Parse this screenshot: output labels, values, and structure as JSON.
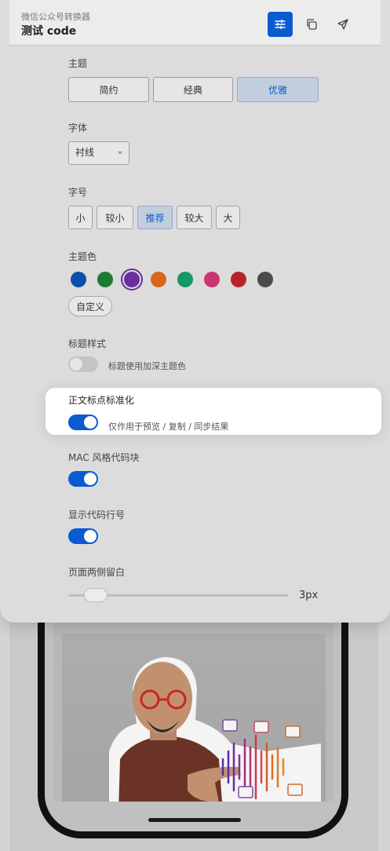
{
  "header": {
    "subtitle": "微信公众号转换器",
    "title": "测试 code",
    "buttons": [
      {
        "icon": "sliders-icon",
        "active": true
      },
      {
        "icon": "copy-icon"
      },
      {
        "icon": "send-icon"
      }
    ]
  },
  "theme": {
    "label": "主题",
    "options": [
      "简约",
      "经典",
      "优雅"
    ],
    "selected": "优雅"
  },
  "font": {
    "label": "字体",
    "value": "衬线"
  },
  "font_size": {
    "label": "字号",
    "options": [
      "小",
      "较小",
      "推荐",
      "较大",
      "大"
    ],
    "selected": "推荐"
  },
  "theme_color": {
    "label": "主题色",
    "swatches": [
      "#0a4fa8",
      "#1f7a34",
      "#6a2e9e",
      "#d8671d",
      "#149868",
      "#c93670",
      "#b8232b",
      "#4a4a4a"
    ],
    "selected_index": 2,
    "custom_label": "自定义"
  },
  "heading_style": {
    "label": "标题样式",
    "toggle_on": false,
    "description": "标题使用加深主题色"
  },
  "punctuation": {
    "label": "正文标点标准化",
    "toggle_on": true,
    "description": "仅作用于预览 / 复制 / 同步结果"
  },
  "mac_code": {
    "label": "MAC 风格代码块",
    "toggle_on": true
  },
  "line_numbers": {
    "label": "显示代码行号",
    "toggle_on": true
  },
  "page_margin": {
    "label": "页面两侧留白",
    "value": "3px"
  },
  "colors": {
    "accent": "#0a5bd0"
  }
}
